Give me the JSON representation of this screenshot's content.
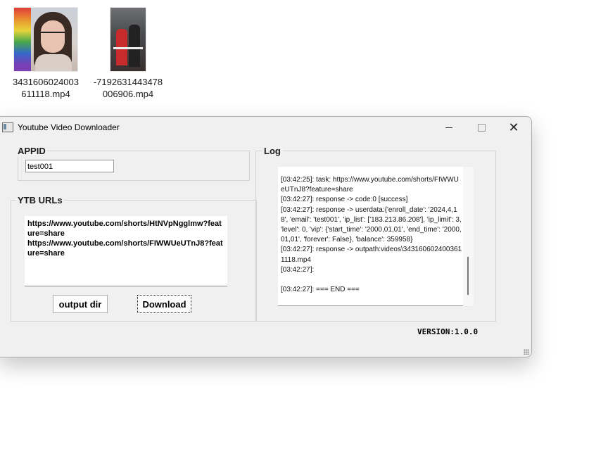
{
  "desktop": {
    "files": [
      {
        "name": "3431606024003611118.mp4"
      },
      {
        "name": "-7192631443478006906.mp4"
      }
    ]
  },
  "window": {
    "title": "Youtube Video Downloader",
    "appid": {
      "label": "APPID",
      "value": "test001"
    },
    "urls": {
      "label": "YTB URLs",
      "lines": [
        "https://www.youtube.com/shorts/HtNVpNgglmw?feature=share",
        "https://www.youtube.com/shorts/FIWWUeUTnJ8?feature=share"
      ]
    },
    "buttons": {
      "output_dir": "output dir",
      "download": "Download"
    },
    "log": {
      "label": "Log",
      "lines": [
        "[03:42:25]: task: https://www.youtube.com/shorts/FIWWUeUTnJ8?feature=share",
        "[03:42:27]: response -> code:0 [success]",
        "[03:42:27]: response -> userdata:{'enroll_date': '2024,4,18', 'email': 'test001', 'ip_list': ['183.213.86.208'], 'ip_limit': 3, 'level': 0, 'vip': {'start_time': '2000,01,01', 'end_time': '2000,01,01', 'forever': False}, 'balance': 359958}",
        "[03:42:27]: response -> outpath:videos\\3431606024003611118.mp4",
        "[03:42:27]:",
        "",
        "[03:42:27]:  === END ==="
      ]
    },
    "version": "VERSION:1.0.0"
  }
}
